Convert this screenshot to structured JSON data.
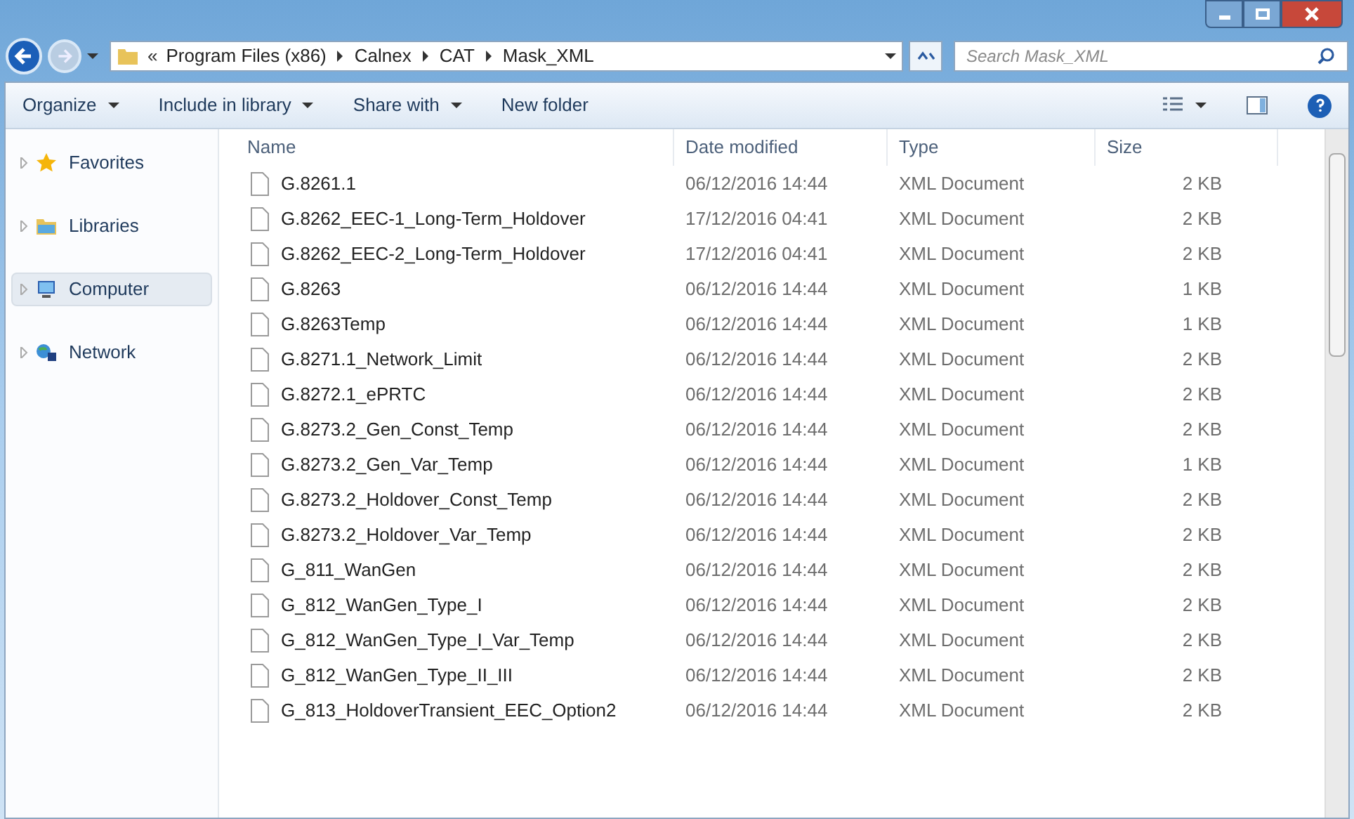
{
  "address_bar": {
    "overflow": "«",
    "crumbs": [
      "Program Files (x86)",
      "Calnex",
      "CAT",
      "Mask_XML"
    ]
  },
  "search": {
    "placeholder": "Search Mask_XML"
  },
  "toolbar": {
    "buttons": [
      {
        "label": "Organize",
        "dropdown": true
      },
      {
        "label": "Include in library",
        "dropdown": true
      },
      {
        "label": "Share with",
        "dropdown": true
      },
      {
        "label": "New folder",
        "dropdown": false
      }
    ]
  },
  "sidebar": {
    "items": [
      {
        "label": "Favorites",
        "kind": "star",
        "selected": false
      },
      {
        "label": "Libraries",
        "kind": "library",
        "selected": false
      },
      {
        "label": "Computer",
        "kind": "computer",
        "selected": true
      },
      {
        "label": "Network",
        "kind": "network",
        "selected": false
      }
    ]
  },
  "table": {
    "columns": [
      "Name",
      "Date modified",
      "Type",
      "Size"
    ],
    "rows": [
      {
        "name": "G.8261.1",
        "date": "06/12/2016 14:44",
        "type": "XML Document",
        "size": "2 KB"
      },
      {
        "name": "G.8262_EEC-1_Long-Term_Holdover",
        "date": "17/12/2016 04:41",
        "type": "XML Document",
        "size": "2 KB"
      },
      {
        "name": "G.8262_EEC-2_Long-Term_Holdover",
        "date": "17/12/2016 04:41",
        "type": "XML Document",
        "size": "2 KB"
      },
      {
        "name": "G.8263",
        "date": "06/12/2016 14:44",
        "type": "XML Document",
        "size": "1 KB"
      },
      {
        "name": "G.8263Temp",
        "date": "06/12/2016 14:44",
        "type": "XML Document",
        "size": "1 KB"
      },
      {
        "name": "G.8271.1_Network_Limit",
        "date": "06/12/2016 14:44",
        "type": "XML Document",
        "size": "2 KB"
      },
      {
        "name": "G.8272.1_ePRTC",
        "date": "06/12/2016 14:44",
        "type": "XML Document",
        "size": "2 KB"
      },
      {
        "name": "G.8273.2_Gen_Const_Temp",
        "date": "06/12/2016 14:44",
        "type": "XML Document",
        "size": "2 KB"
      },
      {
        "name": "G.8273.2_Gen_Var_Temp",
        "date": "06/12/2016 14:44",
        "type": "XML Document",
        "size": "1 KB"
      },
      {
        "name": "G.8273.2_Holdover_Const_Temp",
        "date": "06/12/2016 14:44",
        "type": "XML Document",
        "size": "2 KB"
      },
      {
        "name": "G.8273.2_Holdover_Var_Temp",
        "date": "06/12/2016 14:44",
        "type": "XML Document",
        "size": "2 KB"
      },
      {
        "name": "G_811_WanGen",
        "date": "06/12/2016 14:44",
        "type": "XML Document",
        "size": "2 KB"
      },
      {
        "name": "G_812_WanGen_Type_I",
        "date": "06/12/2016 14:44",
        "type": "XML Document",
        "size": "2 KB"
      },
      {
        "name": "G_812_WanGen_Type_I_Var_Temp",
        "date": "06/12/2016 14:44",
        "type": "XML Document",
        "size": "2 KB"
      },
      {
        "name": "G_812_WanGen_Type_II_III",
        "date": "06/12/2016 14:44",
        "type": "XML Document",
        "size": "2 KB"
      },
      {
        "name": "G_813_HoldoverTransient_EEC_Option2",
        "date": "06/12/2016 14:44",
        "type": "XML Document",
        "size": "2 KB"
      }
    ]
  }
}
